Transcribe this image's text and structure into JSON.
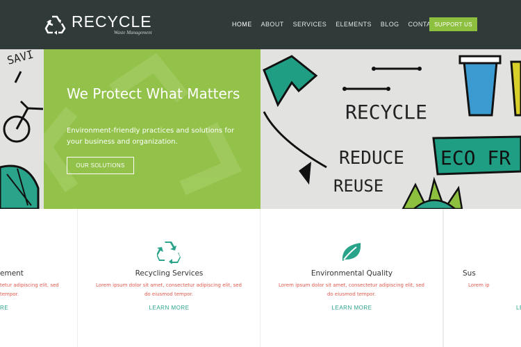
{
  "brand": {
    "name": "RECYCLE",
    "tagline": "Waste Management"
  },
  "nav": {
    "items": [
      "HOME",
      "ABOUT",
      "SERVICES",
      "ELEMENTS",
      "BLOG",
      "CONTACT"
    ],
    "active": "HOME",
    "cta": "SUPPORT US"
  },
  "hero": {
    "title": "We Protect What Matters",
    "subtitle": "Environment-friendly practices and solutions for your business and organization.",
    "button": "OUR SOLUTIONS",
    "illustration_words": [
      "RECYCLE",
      "REDUCE",
      "REUSE",
      "ECO FR",
      "SAVI"
    ]
  },
  "services": {
    "cards": [
      {
        "title": "ement",
        "text": "tetur adipiscing elit, sed",
        "text2": "tempor.",
        "link": "RE",
        "icon": "leaf-icon"
      },
      {
        "title": "Recycling Services",
        "text": "Lorem ipsum dolor sit amet, consectetur adipiscing elit, sed",
        "text2": "do eiusmod tempor.",
        "link": "LEARN MORE",
        "icon": "recycle-icon"
      },
      {
        "title": "Environmental Quality",
        "text": "Lorem ipsum dolor sit amet, consectetur adipiscing elit, sed",
        "text2": "do eiusmod tempor.",
        "link": "LEARN MORE",
        "icon": "leaf-icon"
      },
      {
        "title": "Sus",
        "text": "Lorem ip",
        "text2": "",
        "link": "LE",
        "icon": "leaf-icon"
      }
    ]
  },
  "colors": {
    "header_bg": "#2f3a39",
    "accent_green": "#8dc03f",
    "teal": "#2aa38b",
    "body_text": "#e05a4e"
  }
}
